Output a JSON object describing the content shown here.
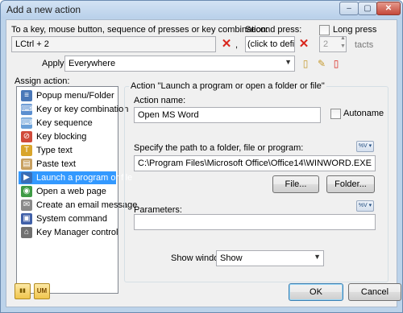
{
  "window": {
    "title": "Add a new action",
    "minimize_glyph": "–",
    "maximize_glyph": "▢",
    "close_glyph": "✕"
  },
  "trigger": {
    "first_label": "To a key, mouse button, sequence of presses or key combination:",
    "first_value": "LCtrl + 2",
    "comma": ",",
    "second_label": "Second press:",
    "second_value": "(click to define)",
    "long_press_label": "Long press",
    "tacts_value": "2",
    "tacts_label": "tacts",
    "clear_glyph": "✕"
  },
  "apply": {
    "label": "Apply",
    "value": "Everywhere"
  },
  "assign": {
    "label": "Assign action:",
    "items": [
      {
        "label": "Popup menu/Folder",
        "icon": "popup-menu-icon",
        "color": "#4a78b8",
        "glyph": "≡"
      },
      {
        "label": "Key or key combination",
        "icon": "key-combination-icon",
        "color": "#5b8fd0",
        "glyph": "⌨"
      },
      {
        "label": "Key sequence",
        "icon": "key-sequence-icon",
        "color": "#6aa0d8",
        "glyph": "⌨"
      },
      {
        "label": "Key blocking",
        "icon": "key-blocking-icon",
        "color": "#d04a3a",
        "glyph": "⊘"
      },
      {
        "label": "Type text",
        "icon": "type-text-icon",
        "color": "#d9a52b",
        "glyph": "T"
      },
      {
        "label": "Paste text",
        "icon": "paste-text-icon",
        "color": "#c8a060",
        "glyph": "▤"
      },
      {
        "label": "Launch a program or file",
        "icon": "launch-program-icon",
        "color": "#3a6db5",
        "glyph": "▶"
      },
      {
        "label": "Open a web page",
        "icon": "web-page-icon",
        "color": "#3f9b46",
        "glyph": "◉"
      },
      {
        "label": "Create an email message",
        "icon": "email-icon",
        "color": "#8a8a8a",
        "glyph": "✉"
      },
      {
        "label": "System command",
        "icon": "system-command-icon",
        "color": "#4060a8",
        "glyph": "▣"
      },
      {
        "label": "Key Manager control",
        "icon": "key-manager-icon",
        "color": "#707070",
        "glyph": "⌂"
      }
    ],
    "selected_index": 6
  },
  "action": {
    "group_title": "Action \"Launch a program or open a folder or file\"",
    "name_label": "Action name:",
    "name_value": "Open MS Word",
    "autoname_label": "Autoname",
    "path_label": "Specify the path to a folder, file or program:",
    "path_value": "C:\\Program Files\\Microsoft Office\\Office14\\WINWORD.EXE",
    "variables_button": "%V",
    "file_button": "File...",
    "folder_button": "Folder...",
    "parameters_label": "Parameters:",
    "parameters_value": "",
    "show_window_label": "Show window",
    "show_window_value": "Show"
  },
  "footer": {
    "ok_label": "OK",
    "cancel_label": "Cancel",
    "tool1_glyph": "▮▮",
    "tool2_glyph": "UM"
  }
}
